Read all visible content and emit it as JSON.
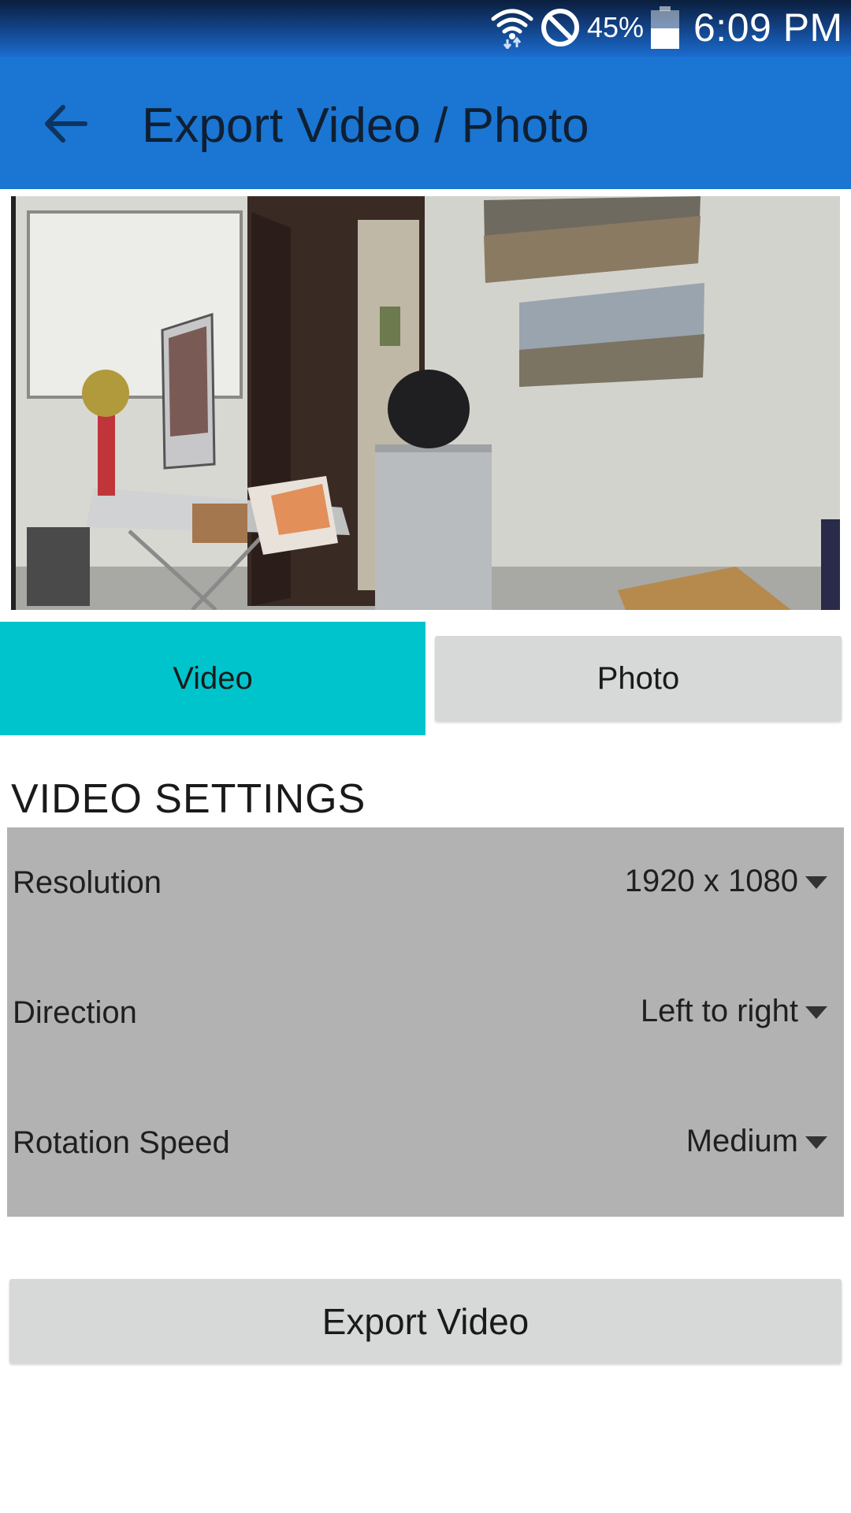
{
  "status_bar": {
    "icons": [
      "wifi-icon",
      "do-not-disturb-icon",
      "battery-icon"
    ],
    "battery_percent": "45%",
    "time": "6:09 PM"
  },
  "toolbar": {
    "back_icon": "arrow-left-icon",
    "title": "Export Video / Photo"
  },
  "tabs": [
    {
      "label": "Video",
      "selected": true
    },
    {
      "label": "Photo",
      "selected": false
    }
  ],
  "section_title": "VIDEO SETTINGS",
  "settings": {
    "resolution": {
      "label": "Resolution",
      "value": "1920 x 1080"
    },
    "direction": {
      "label": "Direction",
      "value": "Left to right"
    },
    "rotation_speed": {
      "label": "Rotation Speed",
      "value": "Medium"
    }
  },
  "export_button": {
    "label": "Export Video"
  },
  "colors": {
    "app_bar": "#1a76d2",
    "selected_tab": "#00c4cc",
    "settings_panel": "#b2b2b2",
    "button": "#d7d8d8"
  }
}
